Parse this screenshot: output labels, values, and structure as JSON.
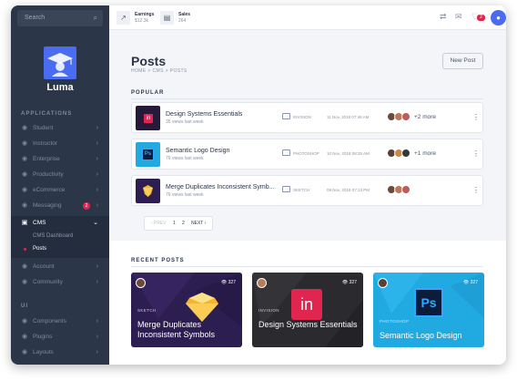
{
  "sidebar": {
    "search_placeholder": "Search",
    "brand": "Luma",
    "applications_heading": "APPLICATIONS",
    "items": [
      {
        "label": "Student"
      },
      {
        "label": "Instructor"
      },
      {
        "label": "Enterprise"
      },
      {
        "label": "Productivity"
      },
      {
        "label": "eCommerce"
      },
      {
        "label": "Messaging",
        "badge": "2"
      },
      {
        "label": "CMS"
      },
      {
        "label": "Account"
      },
      {
        "label": "Community"
      }
    ],
    "cms_sub": [
      "CMS Dashboard",
      "Posts"
    ],
    "ui_heading": "UI",
    "ui_items": [
      {
        "label": "Components"
      },
      {
        "label": "Plugins"
      },
      {
        "label": "Layouts"
      }
    ]
  },
  "topbar": {
    "earnings_label": "Earnings",
    "earnings_value": "$12.3k",
    "sales_label": "Sales",
    "sales_value": "264",
    "notification_count": "2"
  },
  "page": {
    "title": "Posts",
    "breadcrumb": "HOME > CMS > POSTS",
    "new_post": "New Post",
    "popular_heading": "POPULAR",
    "recent_heading": "RECENT POSTS"
  },
  "popular": [
    {
      "title": "Design Systems Essentials",
      "views": "35 views last week",
      "folder": "INVISION",
      "date": "11 Nov, 2018 07:46 AM",
      "more": "+2 more"
    },
    {
      "title": "Semantic Logo Design",
      "views": "76 views last week",
      "folder": "PHOTOSHOP",
      "date": "10 Nov, 2018 08:25 AM",
      "more": "+1 more"
    },
    {
      "title": "Merge Duplicates Inconsistent Symb...",
      "views": "76 views last week",
      "folder": "SKETCH",
      "date": "09 Nov, 2018 07:13 PM",
      "more": ""
    }
  ],
  "pager": {
    "prev": "‹ PREV",
    "page1": "1",
    "page2": "2",
    "next": "NEXT ›"
  },
  "recent": [
    {
      "views": "327",
      "category": "SKETCH",
      "title": "Merge Duplicates Inconsistent Symbols",
      "bg": "#2d1e52",
      "icon": "sketch-icon"
    },
    {
      "views": "327",
      "category": "INVISION",
      "title": "Design Systems Essentials",
      "bg": "#2a2a2f",
      "icon": "invision-icon"
    },
    {
      "views": "327",
      "category": "PHOTOSHOP",
      "title": "Semantic Logo Design",
      "bg": "#21a9e1",
      "icon": "photoshop-icon"
    }
  ]
}
